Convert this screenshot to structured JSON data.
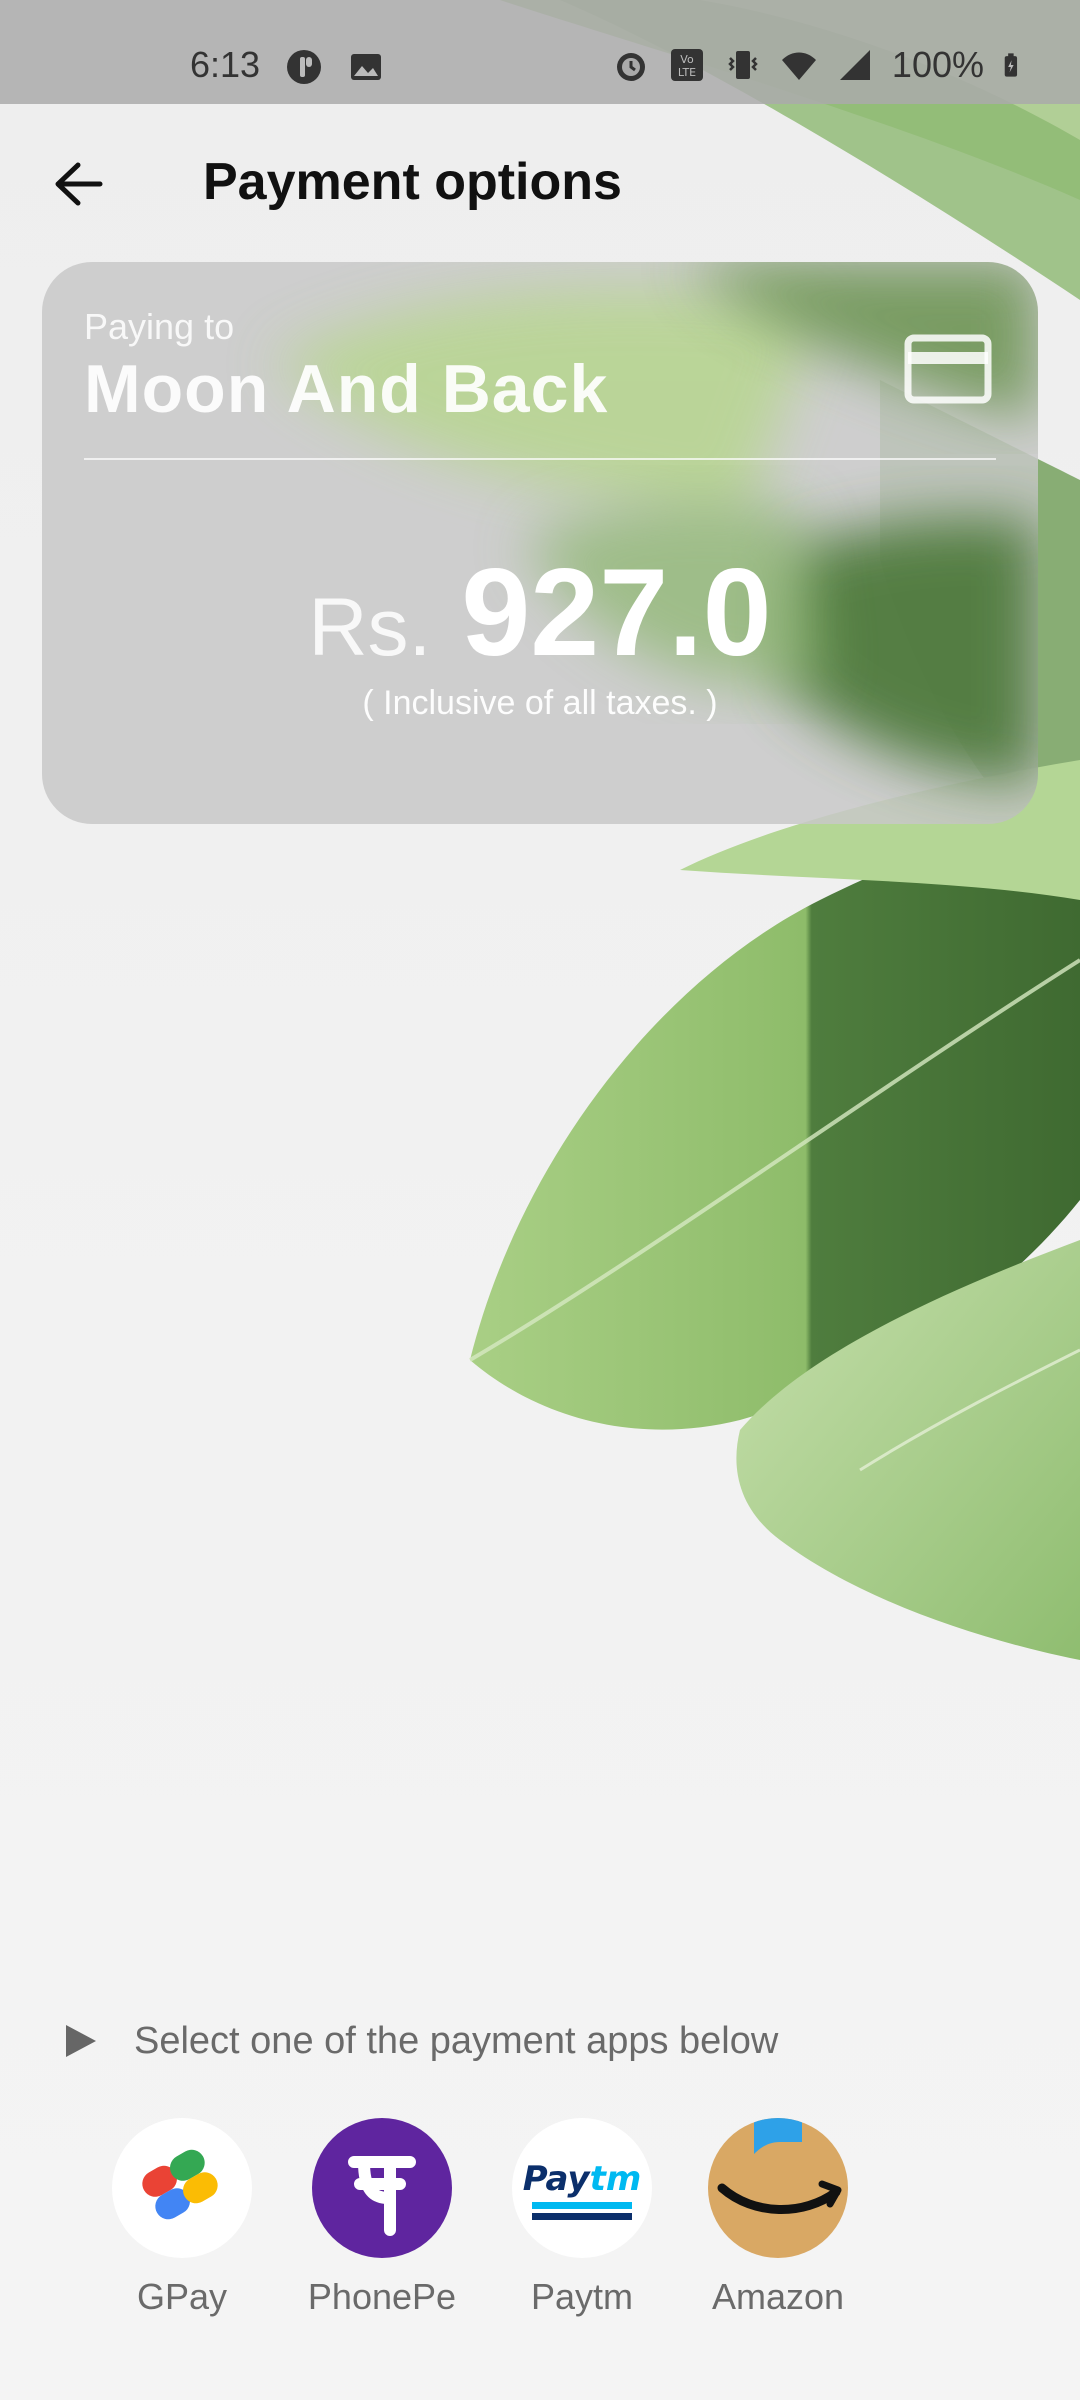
{
  "status_bar": {
    "time": "6:13",
    "battery": "100%",
    "icons": [
      "pill-icon",
      "image-icon",
      "alarm-icon",
      "volte-icon",
      "vibrate-icon",
      "wifi-icon",
      "signal-icon",
      "battery-charging-icon"
    ]
  },
  "app_bar": {
    "title": "Payment options",
    "back_icon": "arrow-left-icon"
  },
  "card": {
    "paying_to_label": "Paying to",
    "merchant": "Moon And Back",
    "currency": "Rs.",
    "amount": "927.0",
    "tax_note": "( Inclusive of all taxes. )",
    "icon": "credit-card-icon"
  },
  "prompt": {
    "text": "Select one of the payment apps below",
    "icon": "play-icon"
  },
  "apps": [
    {
      "label": "GPay",
      "icon": "gpay-logo"
    },
    {
      "label": "PhonePe",
      "icon": "phonepe-logo"
    },
    {
      "label": "Paytm",
      "icon": "paytm-logo",
      "logo_text": "Paytm"
    },
    {
      "label": "Amazon",
      "icon": "amazon-logo"
    }
  ],
  "colors": {
    "phonepe": "#5f259f",
    "paytm_blue": "#0b2f6b",
    "paytm_light": "#00b9f1",
    "amazon_bg": "#d9a864",
    "leaf_dark": "#4d7a3a",
    "leaf_light": "#9cc77a"
  }
}
